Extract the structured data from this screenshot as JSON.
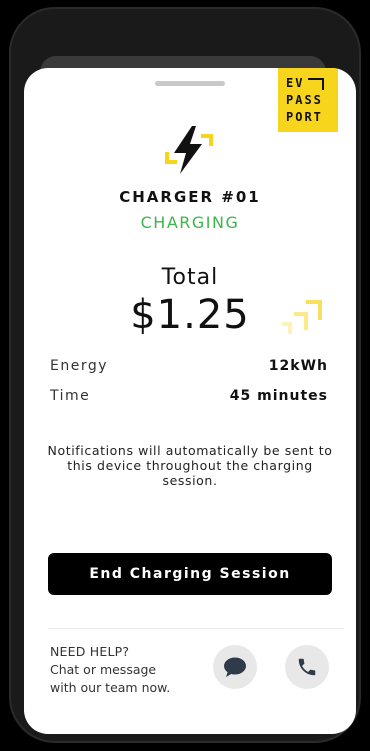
{
  "brand": {
    "line1": "EV",
    "line2": "PASS",
    "line3": "PORT",
    "color": "#f7d51d"
  },
  "charger": {
    "title": "CHARGER #01",
    "status": "CHARGING",
    "status_color": "#3db54a"
  },
  "total": {
    "label": "Total",
    "value": "$1.25"
  },
  "details": {
    "energy": {
      "label": "Energy",
      "value": "12kWh"
    },
    "time": {
      "label": "Time",
      "value": "45 minutes"
    }
  },
  "notice": "Notifications will automatically be sent to this device throughout the charging session.",
  "actions": {
    "end_label": "End Charging Session"
  },
  "help": {
    "title": "NEED HELP?",
    "line1": "Chat or message",
    "line2": "with our team now."
  },
  "icons": {
    "charger": "lightning-bolt-icon",
    "chat": "chat-bubble-icon",
    "phone": "phone-icon"
  },
  "colors": {
    "accent": "#f7d51d",
    "button": "#000000"
  }
}
